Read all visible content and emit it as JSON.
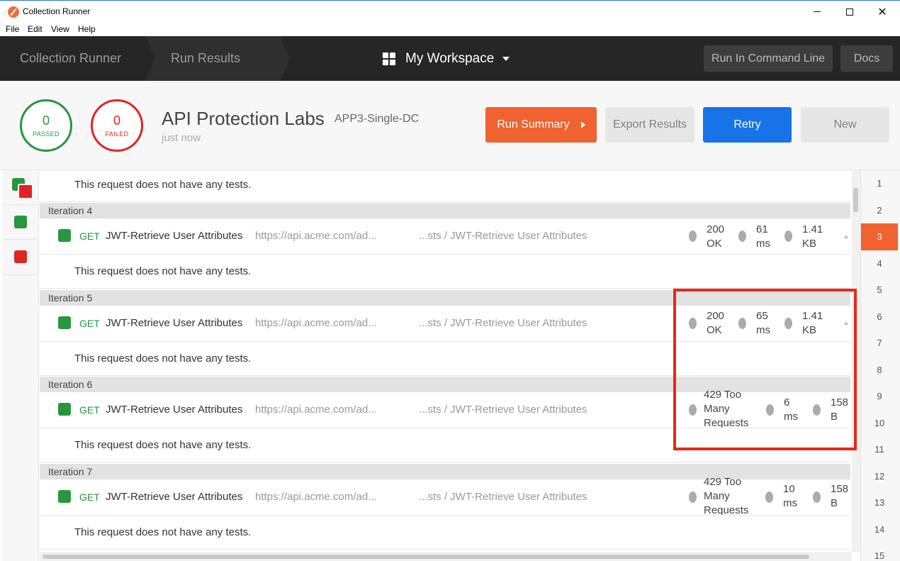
{
  "window": {
    "title": "Collection Runner"
  },
  "menu": [
    "File",
    "Edit",
    "View",
    "Help"
  ],
  "nav": {
    "breadcrumbs": [
      "Collection Runner",
      "Run Results"
    ],
    "workspace": "My Workspace",
    "run_cmd_label": "Run In Command Line",
    "docs_label": "Docs"
  },
  "summary": {
    "passed": "0",
    "passed_label": "PASSED",
    "failed": "0",
    "failed_label": "FAILED",
    "collection": "API Protection Labs",
    "environment": "APP3-Single-DC",
    "time": "just now",
    "run_summary_label": "Run Summary",
    "export_label": "Export Results",
    "retry_label": "Retry",
    "new_label": "New"
  },
  "colors": {
    "pass": "#27963d",
    "fail": "#e02424",
    "accent": "#f0622f",
    "primary": "#1873e8",
    "highlight": "#e8281b"
  },
  "no_tests_text": "This request does not have any tests.",
  "iterations": [
    {
      "label": "Iteration 4",
      "method": "GET",
      "name": "JWT-Retrieve User Attributes",
      "url": "https://api.acme.com/ad...",
      "path": "...sts / JWT-Retrieve User Attributes",
      "status": [
        "200",
        "OK"
      ],
      "time": [
        "61",
        "ms"
      ],
      "size": [
        "1.41",
        "KB"
      ]
    },
    {
      "label": "Iteration 5",
      "method": "GET",
      "name": "JWT-Retrieve User Attributes",
      "url": "https://api.acme.com/ad...",
      "path": "...sts / JWT-Retrieve User Attributes",
      "status": [
        "200",
        "OK"
      ],
      "time": [
        "65",
        "ms"
      ],
      "size": [
        "1.41",
        "KB"
      ]
    },
    {
      "label": "Iteration 6",
      "method": "GET",
      "name": "JWT-Retrieve User Attributes",
      "url": "https://api.acme.com/ad...",
      "path": "...sts / JWT-Retrieve User Attributes",
      "status": [
        "429 Too",
        "Many",
        "Requests"
      ],
      "time": [
        "6",
        "ms"
      ],
      "size": [
        "158",
        "B"
      ]
    },
    {
      "label": "Iteration 7",
      "method": "GET",
      "name": "JWT-Retrieve User Attributes",
      "url": "https://api.acme.com/ad...",
      "path": "...sts / JWT-Retrieve User Attributes",
      "status": [
        "429 Too",
        "Many",
        "Requests"
      ],
      "time": [
        "10",
        "ms"
      ],
      "size": [
        "158",
        "B"
      ]
    }
  ],
  "iteration_numbers": [
    "1",
    "2",
    "3",
    "4",
    "5",
    "6",
    "7",
    "8",
    "9",
    "10",
    "11",
    "12",
    "13",
    "14",
    "15"
  ],
  "active_iteration": "3"
}
